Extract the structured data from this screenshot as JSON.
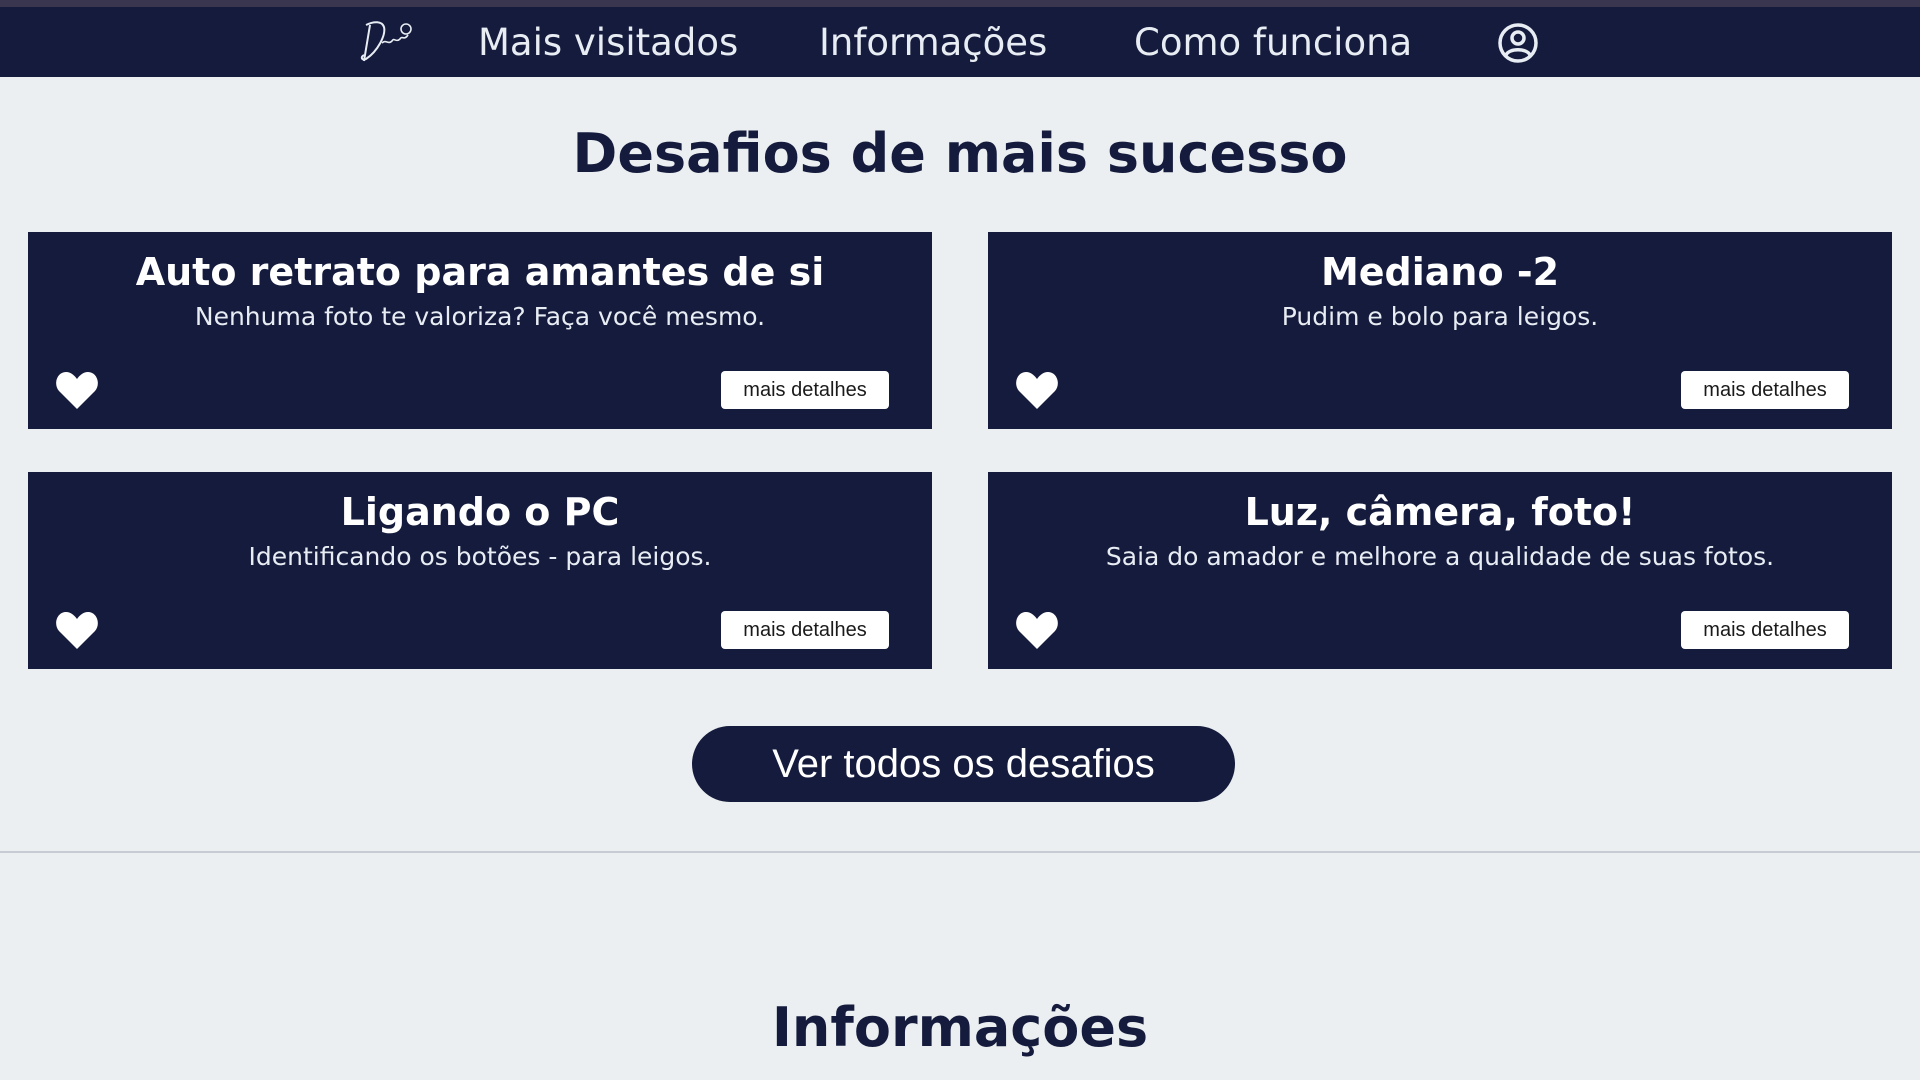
{
  "nav": {
    "logo_icon": "signature-logo-icon",
    "links": [
      "Mais visitados",
      "Informações",
      "Como funciona"
    ],
    "account_icon": "user-circle-icon"
  },
  "main": {
    "title": "Desafios de mais sucesso",
    "cards": [
      {
        "title": "Auto retrato para amantes de si",
        "subtitle": "Nenhuma foto te valoriza? Faça você mesmo.",
        "button": "mais detalhes",
        "icon": "heart-icon"
      },
      {
        "title": "Mediano -2",
        "subtitle": "Pudim e bolo para leigos.",
        "button": "mais detalhes",
        "icon": "heart-icon"
      },
      {
        "title": "Ligando o PC",
        "subtitle": "Identificando os botões - para leigos.",
        "button": "mais detalhes",
        "icon": "heart-icon"
      },
      {
        "title": "Luz, câmera, foto!",
        "subtitle": "Saia do amador e melhore a qualidade de suas fotos.",
        "button": "mais detalhes",
        "icon": "heart-icon"
      }
    ],
    "cta_label": "Ver todos os desafios"
  },
  "info": {
    "title": "Informações"
  },
  "colors": {
    "navy": "#141b3c",
    "background": "#ebeff1",
    "white": "#ffffff"
  }
}
